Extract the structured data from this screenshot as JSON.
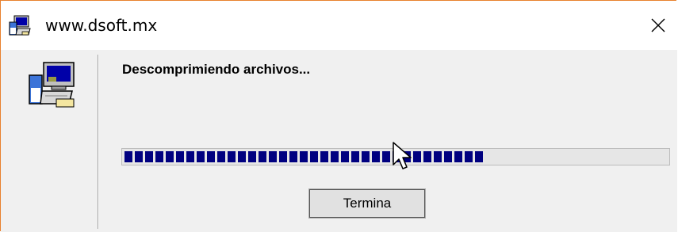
{
  "window": {
    "title": "www.dsoft.mx",
    "accent_border_color": "#e8812e"
  },
  "icons": {
    "title_icon": "setup-computer-icon",
    "main_icon": "setup-computer-icon",
    "close_icon": "close-icon"
  },
  "content": {
    "status_text": "Descomprimiendo archivos...",
    "progress_fraction": 0.65,
    "progress_color": "#000080"
  },
  "buttons": {
    "finish_label": "Termina"
  }
}
